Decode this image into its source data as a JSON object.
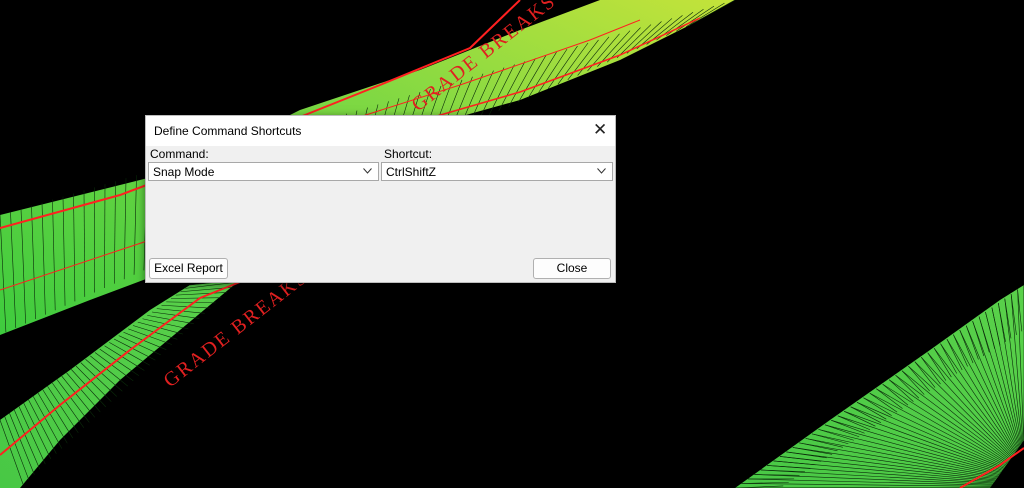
{
  "background": {
    "annotations": [
      "GRADE BREAKS",
      "GRADE BREAKS"
    ],
    "colors": {
      "surface": "#4fd04a",
      "surface_yellow": "#b8e040",
      "breakline": "#ff2020",
      "mesh": "#0a2a0a"
    }
  },
  "dialog": {
    "title": "Define Command Shortcuts",
    "close_icon": "close-icon",
    "command_label": "Command:",
    "command_value": "Snap Mode",
    "shortcut_label": "Shortcut:",
    "shortcut_value": "CtrlShiftZ",
    "excel_report_label": "Excel Report",
    "close_label": "Close"
  }
}
